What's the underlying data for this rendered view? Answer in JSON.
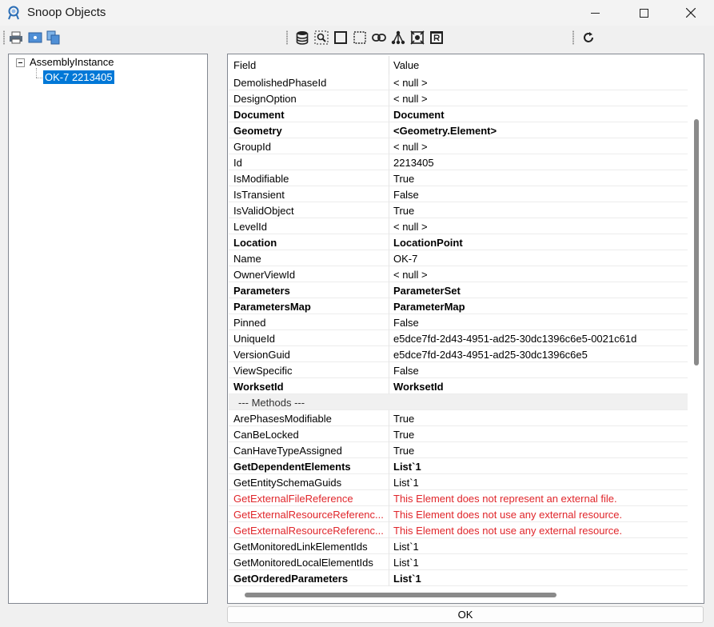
{
  "window": {
    "title": "Snoop Objects"
  },
  "icons": {
    "app": "snoop-magnifier-icon",
    "minimize": "minimize-icon",
    "maximize": "maximize-icon",
    "close": "close-icon",
    "toolbar_left": [
      "print-icon",
      "print-preview-icon",
      "copy-icon"
    ],
    "toolbar_mid": [
      "database-icon",
      "select-zoom-icon",
      "rectangle-icon",
      "dashed-rectangle-icon",
      "link-icon",
      "hierarchy-icon",
      "settings-frame-icon",
      "revit-r-icon"
    ],
    "toolbar_right": [
      "refresh-icon"
    ]
  },
  "tree": {
    "root": "AssemblyInstance",
    "child": "OK-7 2213405"
  },
  "grid": {
    "header_field": "Field",
    "header_value": "Value",
    "rows": [
      {
        "field": "DemolishedPhaseId",
        "value": "< null >",
        "style": ""
      },
      {
        "field": "DesignOption",
        "value": "< null >",
        "style": ""
      },
      {
        "field": "Document",
        "value": "Document",
        "style": "bold"
      },
      {
        "field": "Geometry",
        "value": "<Geometry.Element>",
        "style": "bold"
      },
      {
        "field": "GroupId",
        "value": "< null >",
        "style": ""
      },
      {
        "field": "Id",
        "value": "2213405",
        "style": ""
      },
      {
        "field": "IsModifiable",
        "value": "True",
        "style": ""
      },
      {
        "field": "IsTransient",
        "value": "False",
        "style": ""
      },
      {
        "field": "IsValidObject",
        "value": "True",
        "style": ""
      },
      {
        "field": "LevelId",
        "value": "< null >",
        "style": ""
      },
      {
        "field": "Location",
        "value": "LocationPoint",
        "style": "bold"
      },
      {
        "field": "Name",
        "value": "OK-7",
        "style": ""
      },
      {
        "field": "OwnerViewId",
        "value": "< null >",
        "style": ""
      },
      {
        "field": "Parameters",
        "value": "ParameterSet",
        "style": "bold"
      },
      {
        "field": "ParametersMap",
        "value": "ParameterMap",
        "style": "bold"
      },
      {
        "field": "Pinned",
        "value": "False",
        "style": ""
      },
      {
        "field": "UniqueId",
        "value": "e5dce7fd-2d43-4951-ad25-30dc1396c6e5-0021c61d",
        "style": ""
      },
      {
        "field": "VersionGuid",
        "value": "e5dce7fd-2d43-4951-ad25-30dc1396c6e5",
        "style": ""
      },
      {
        "field": "ViewSpecific",
        "value": "False",
        "style": ""
      },
      {
        "field": "WorksetId",
        "value": "WorksetId",
        "style": "bold"
      },
      {
        "field": "--- Methods ---",
        "value": "",
        "style": "section"
      },
      {
        "field": "ArePhasesModifiable",
        "value": "True",
        "style": ""
      },
      {
        "field": "CanBeLocked",
        "value": "True",
        "style": ""
      },
      {
        "field": "CanHaveTypeAssigned",
        "value": "True",
        "style": ""
      },
      {
        "field": "GetDependentElements",
        "value": "List`1",
        "style": "bold"
      },
      {
        "field": "GetEntitySchemaGuids",
        "value": "List`1",
        "style": ""
      },
      {
        "field": "GetExternalFileReference",
        "value": "This Element does not represent an external file.",
        "style": "err"
      },
      {
        "field": "GetExternalResourceReferenc...",
        "value": "This Element does not use any external resource.",
        "style": "err"
      },
      {
        "field": "GetExternalResourceReferenc...",
        "value": "This Element does not use any external resource.",
        "style": "err"
      },
      {
        "field": "GetMonitoredLinkElementIds",
        "value": "List`1",
        "style": ""
      },
      {
        "field": "GetMonitoredLocalElementIds",
        "value": "List`1",
        "style": ""
      },
      {
        "field": "GetOrderedParameters",
        "value": "List`1",
        "style": "bold"
      }
    ]
  },
  "footer": {
    "ok_label": "OK"
  },
  "colors": {
    "selection": "#0078d7",
    "error_text": "#e0262b"
  }
}
